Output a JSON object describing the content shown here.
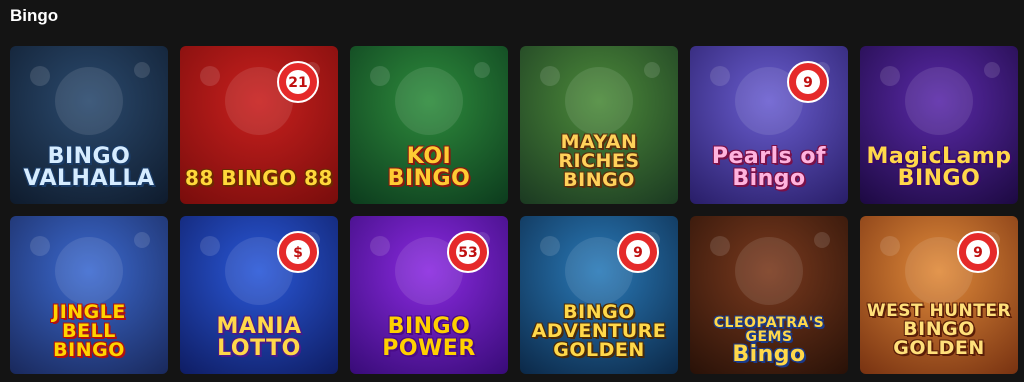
{
  "section": {
    "title": "Bingo"
  },
  "games": [
    {
      "id": "bingo-valhalla",
      "lines": [
        "BINGO",
        "VALHALLA"
      ],
      "bg": [
        "#2b4a6e",
        "#0f1c2e"
      ],
      "fg": "#d6ecff",
      "stroke": "#1a3b66",
      "icon": "viking-warrior-icon"
    },
    {
      "id": "88-bingo-88",
      "lines": [
        "88 BINGO 88"
      ],
      "ball": "21",
      "bg": [
        "#c8201e",
        "#7a0d0c"
      ],
      "fg": "#ffd83a",
      "stroke": "#6b2a00",
      "icon": "bingo-card-icon"
    },
    {
      "id": "koi-bingo",
      "lines": [
        "KOI",
        "BINGO"
      ],
      "bg": [
        "#2e8b3c",
        "#0d3d1e"
      ],
      "fg": "#ffcc33",
      "stroke": "#8a1a10",
      "icon": "koi-fish-icon"
    },
    {
      "id": "mayan-riches-bingo",
      "lines": [
        "MAYAN",
        "RICHES",
        "BINGO"
      ],
      "bg": [
        "#4c8a3a",
        "#1c3b22"
      ],
      "fg": "#ffd25a",
      "stroke": "#5a2e0c",
      "icon": "temple-icon"
    },
    {
      "id": "pearls-of-bingo",
      "lines": [
        "Pearls of",
        "Bingo"
      ],
      "ball": "9",
      "bg": [
        "#6a5ed0",
        "#2a1f6a"
      ],
      "fg": "#ffb3de",
      "stroke": "#7a1048",
      "icon": "mermaid-icon"
    },
    {
      "id": "magic-lamp-bingo",
      "lines": [
        "MagicLamp",
        "BINGO"
      ],
      "bg": [
        "#5a2aa8",
        "#1e0a44"
      ],
      "fg": "#ffd84a",
      "stroke": "#3a0a6a",
      "icon": "magic-lamp-icon"
    },
    {
      "id": "jingle-bell-bingo",
      "lines": [
        "JINGLE",
        "BELL",
        "BINGO"
      ],
      "bg": [
        "#3c6ad0",
        "#1a2a5e"
      ],
      "fg": "#ffd400",
      "stroke": "#b01010",
      "icon": "santa-icon"
    },
    {
      "id": "mania-lotto",
      "lines": [
        "MANIA",
        "LOTTO"
      ],
      "ball": "$",
      "bg": [
        "#2a58d8",
        "#0f1e66"
      ],
      "fg": "#ffd84a",
      "stroke": "#4a1a8a",
      "icon": "lotto-ball-icon"
    },
    {
      "id": "bingo-power",
      "lines": [
        "BINGO",
        "POWER"
      ],
      "ball": "53",
      "bg": [
        "#8a2ae0",
        "#3a0c7a"
      ],
      "fg": "#ffd000",
      "stroke": "#4a0a88",
      "icon": "lotto-ball-icon"
    },
    {
      "id": "bingo-adventure-golden",
      "lines": [
        "BINGO",
        "ADVENTURE",
        "GOLDEN"
      ],
      "ball": "9",
      "bg": [
        "#2a7ab8",
        "#0c2a4a"
      ],
      "fg": "#ffd84a",
      "stroke": "#4a2a08",
      "icon": "pirate-ship-icon"
    },
    {
      "id": "cleopatras-gems-bingo",
      "lines": [
        "CLEOPATRA'S GEMS",
        "Bingo"
      ],
      "bg": [
        "#7a3a1e",
        "#2a1208"
      ],
      "fg": "#ffd84a",
      "stroke": "#1a3a8a",
      "icon": "cat-icon"
    },
    {
      "id": "west-hunter-bingo-golden",
      "lines": [
        "WEST HUNTER",
        "BINGO",
        "GOLDEN"
      ],
      "ball": "9",
      "bg": [
        "#e08a3a",
        "#7a3412"
      ],
      "fg": "#ffe07a",
      "stroke": "#5a1e08",
      "icon": "cowboy-hat-icon"
    }
  ]
}
